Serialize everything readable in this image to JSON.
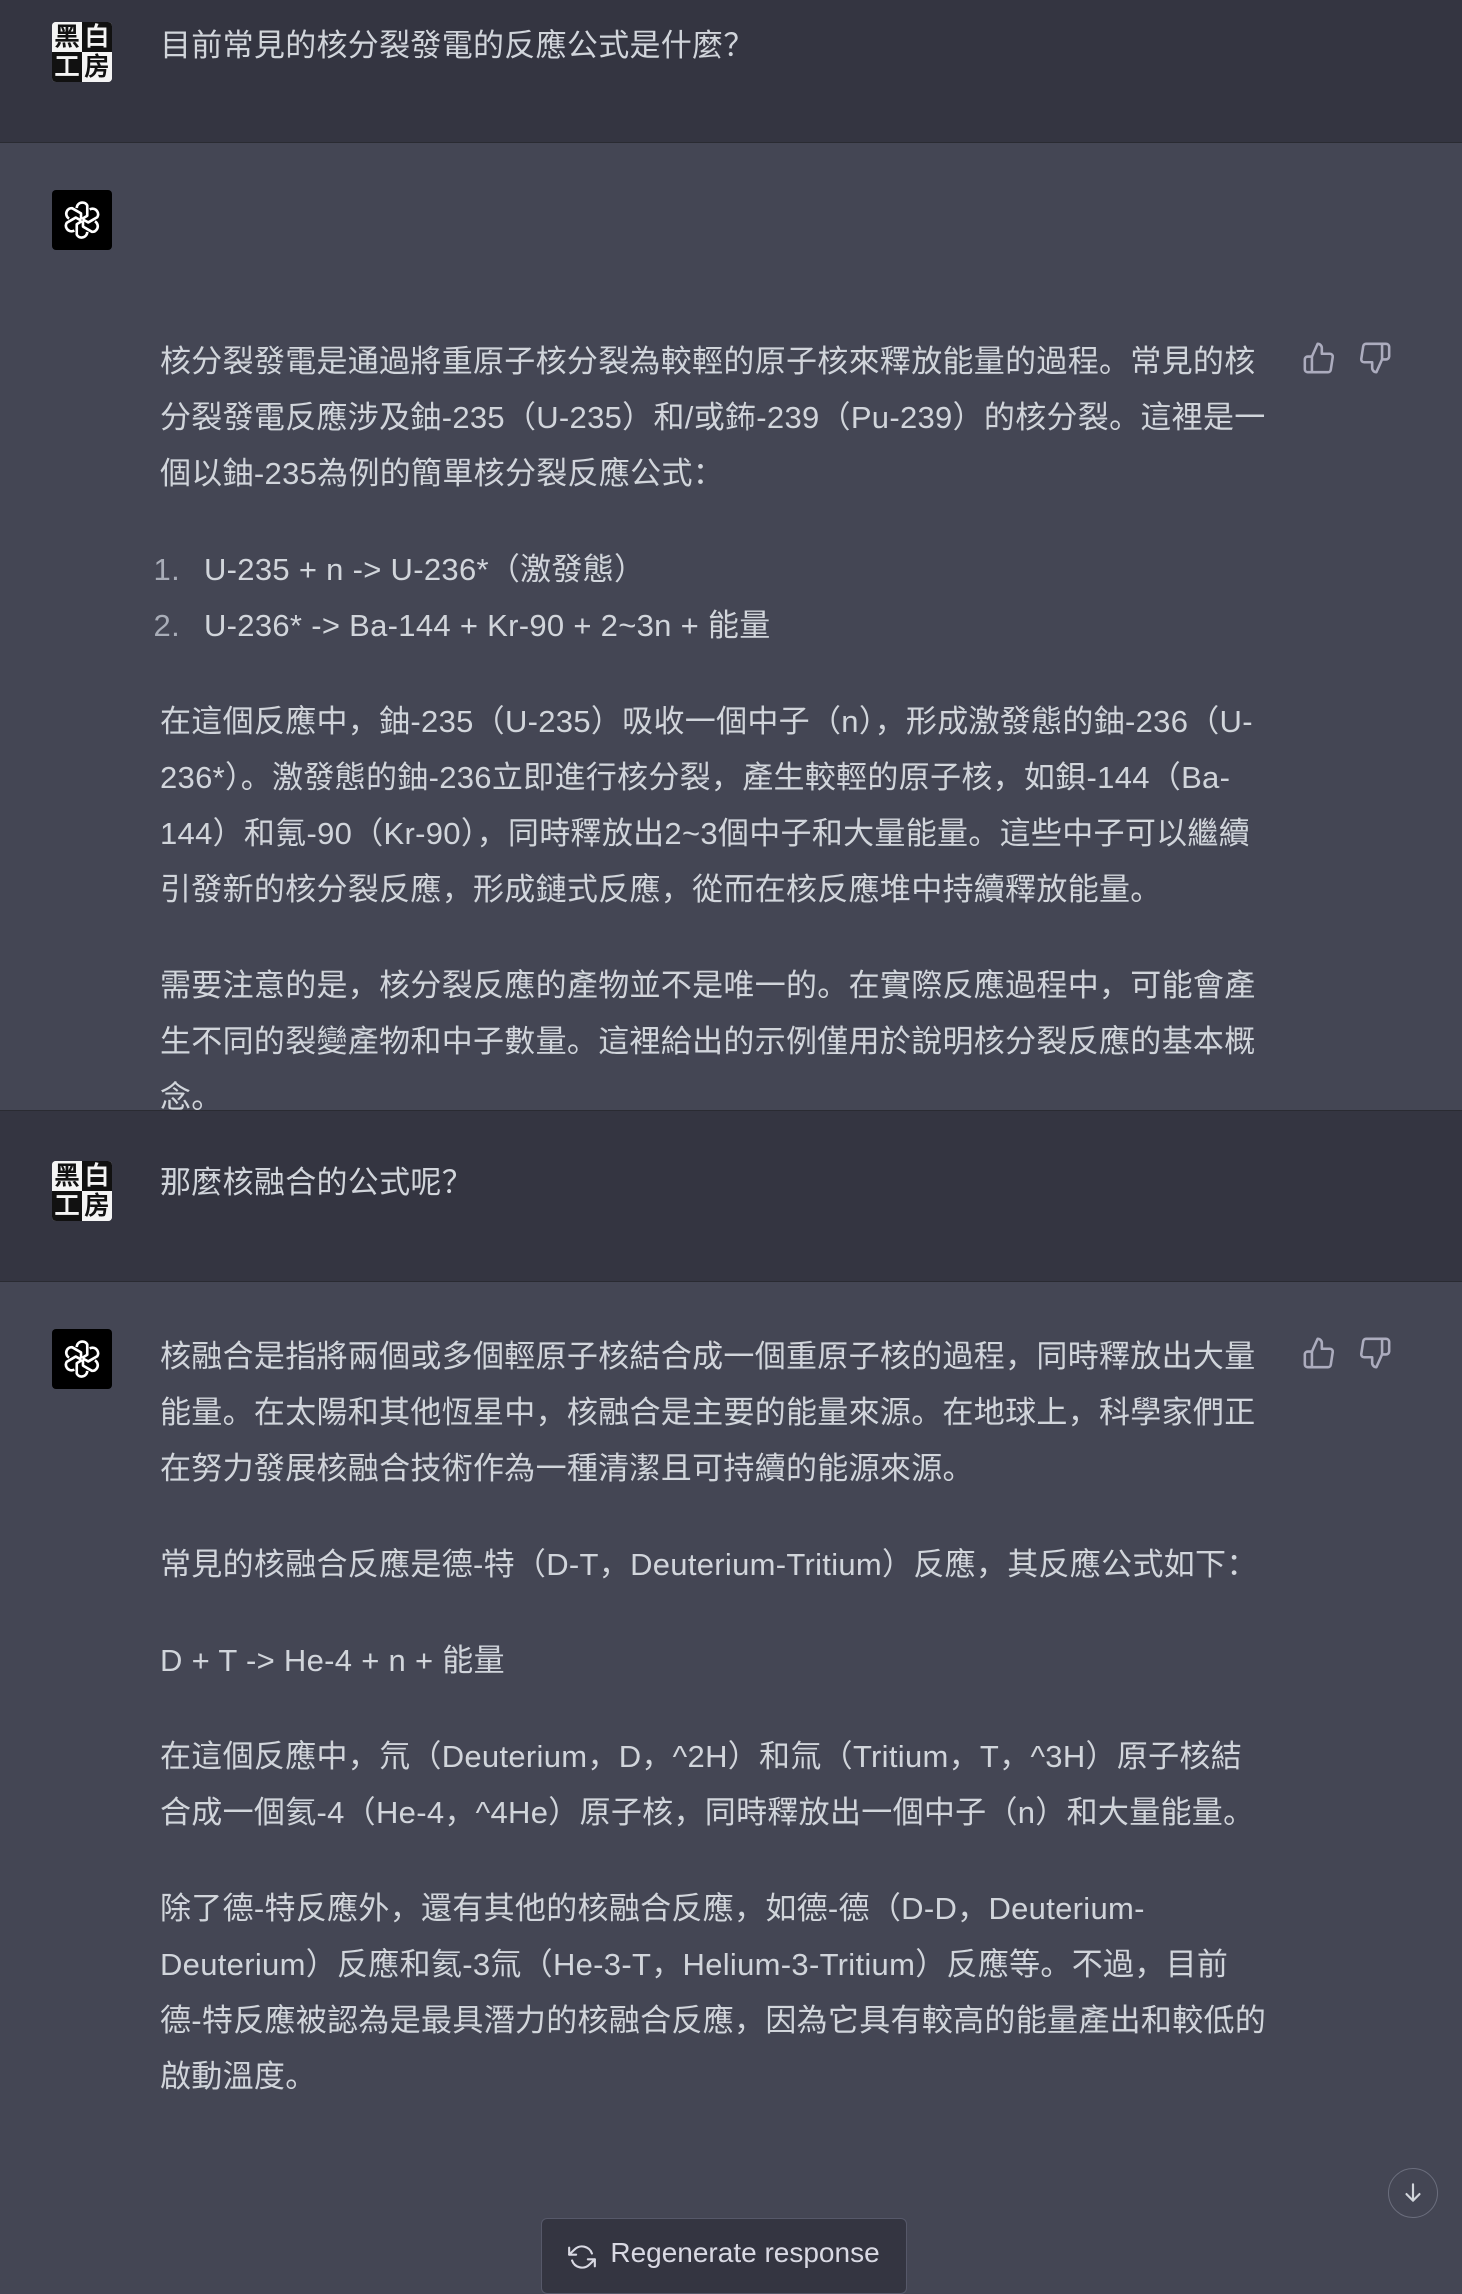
{
  "messages": [
    {
      "role": "user",
      "avatar_chars": [
        "黑",
        "白",
        "工",
        "房"
      ],
      "text": "目前常見的核分裂發電的反應公式是什麼？"
    },
    {
      "role": "assistant",
      "avatar_icon": "openai-logo-icon",
      "paragraphs_before_list": [
        "核分裂發電是通過將重原子核分裂為較輕的原子核來釋放能量的過程。常見的核分裂發電反應涉及鈾-235（U-235）和/或鈽-239（Pu-239）的核分裂。這裡是一個以鈾-235為例的簡單核分裂反應公式："
      ],
      "list": [
        {
          "num": "1.",
          "text": "U-235 + n -> U-236*（激發態）"
        },
        {
          "num": "2.",
          "text": "U-236* -> Ba-144 + Kr-90 + 2~3n + 能量"
        }
      ],
      "paragraphs_after_list": [
        "在這個反應中，鈾-235（U-235）吸收一個中子（n），形成激發態的鈾-236（U-236*）。激發態的鈾-236立即進行核分裂，產生較輕的原子核，如鋇-144（Ba-144）和氪-90（Kr-90），同時釋放出2~3個中子和大量能量。這些中子可以繼續引發新的核分裂反應，形成鏈式反應，從而在核反應堆中持續釋放能量。",
        "需要注意的是，核分裂反應的產物並不是唯一的。在實際反應過程中，可能會產生不同的裂變產物和中子數量。這裡給出的示例僅用於說明核分裂反應的基本概念。"
      ]
    },
    {
      "role": "user",
      "avatar_chars": [
        "黑",
        "白",
        "工",
        "房"
      ],
      "text": "那麼核融合的公式呢？"
    },
    {
      "role": "assistant",
      "avatar_icon": "openai-logo-icon",
      "paragraphs": [
        "核融合是指將兩個或多個輕原子核結合成一個重原子核的過程，同時釋放出大量能量。在太陽和其他恆星中，核融合是主要的能量來源。在地球上，科學家們正在努力發展核融合技術作為一種清潔且可持續的能源來源。",
        "常見的核融合反應是德-特（D-T，Deuterium-Tritium）反應，其反應公式如下：",
        "D + T -> He-4 + n + 能量",
        "在這個反應中，氘（Deuterium，D，^2H）和氚（Tritium，T，^3H）原子核結合成一個氦-4（He-4，^4He）原子核，同時釋放出一個中子（n）和大量能量。",
        "除了德-特反應外，還有其他的核融合反應，如德-德（D-D，Deuterium-Deuterium）反應和氦-3氚（He-3-T，Helium-3-Tritium）反應等。不過，目前德-特反應被認為是最具潛力的核融合反應，因為它具有較高的能量產出和較低的啟動溫度。"
      ]
    }
  ],
  "feedback": {
    "thumbs_up_icon": "thumbs-up-icon",
    "thumbs_down_icon": "thumbs-down-icon"
  },
  "regenerate_button": {
    "label": "Regenerate response",
    "icon": "refresh-icon"
  },
  "scroll_button": {
    "icon": "arrow-down-icon"
  },
  "colors": {
    "user_bg": "#343541",
    "assistant_bg": "#444654",
    "text": "#d1d5db"
  }
}
